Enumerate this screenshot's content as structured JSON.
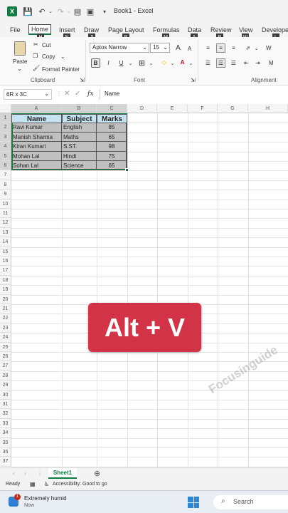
{
  "titlebar": {
    "title": "Book1  -  Excel"
  },
  "tabs": [
    {
      "label": "File",
      "key": ""
    },
    {
      "label": "Home",
      "key": "H"
    },
    {
      "label": "Insert",
      "key": "N"
    },
    {
      "label": "Draw",
      "key": "JI"
    },
    {
      "label": "Page Layout",
      "key": "P"
    },
    {
      "label": "Formulas",
      "key": "M"
    },
    {
      "label": "Data",
      "key": "A"
    },
    {
      "label": "Review",
      "key": "R"
    },
    {
      "label": "View",
      "key": "W"
    },
    {
      "label": "Develope",
      "key": "L"
    }
  ],
  "ribbon": {
    "clipboard": {
      "paste": "Paste",
      "cut": "Cut",
      "copy": "Copy",
      "format_painter": "Format Painter",
      "label": "Clipboard"
    },
    "font": {
      "name": "Aptos Narrow",
      "size": "15",
      "label": "Font",
      "bold": "B",
      "italic": "I",
      "underline": "U",
      "grow": "A",
      "shrink": "A"
    },
    "alignment": {
      "label": "Alignment",
      "wrap": "W",
      "merge": "M"
    }
  },
  "formula_bar": {
    "name_box": "6R x 3C",
    "fx": "fx",
    "content": "Name"
  },
  "grid": {
    "columns": [
      "A",
      "B",
      "C",
      "D",
      "E",
      "F",
      "G",
      "H"
    ],
    "rows": [
      "1",
      "2",
      "3",
      "4",
      "5",
      "6",
      "7",
      "8",
      "9",
      "10",
      "11",
      "12",
      "13",
      "14",
      "15",
      "16",
      "17",
      "18",
      "19",
      "20",
      "21",
      "22",
      "23",
      "24",
      "25",
      "26",
      "27",
      "28",
      "29",
      "30",
      "31",
      "32",
      "33",
      "34",
      "35",
      "36",
      "37"
    ],
    "headers": [
      "Name",
      "Subject",
      "Marks"
    ],
    "data": [
      [
        "Ravi Kumar",
        "English",
        "85"
      ],
      [
        "Manish Sharma",
        "Maths",
        "65"
      ],
      [
        "Kiran Kumari",
        "S.ST.",
        "98"
      ],
      [
        "Mohan Lal",
        "Hindi",
        "75"
      ],
      [
        "Sohan Lal",
        "Science",
        "65"
      ]
    ]
  },
  "overlay": {
    "text": "Alt + V"
  },
  "watermark": "Focusinguide",
  "sheets": {
    "active": "Sheet1"
  },
  "status": {
    "ready": "Ready",
    "accessibility": "Accessibility: Good to go"
  },
  "taskbar": {
    "weather": "Extremely humid",
    "weather_sub": "Now",
    "badge": "1",
    "search": "Search"
  },
  "colors": {
    "excel_green": "#107c41",
    "overlay_red": "#d33346",
    "header_fill": "#c5e3f0",
    "data_fill": "#c0c0c0"
  }
}
